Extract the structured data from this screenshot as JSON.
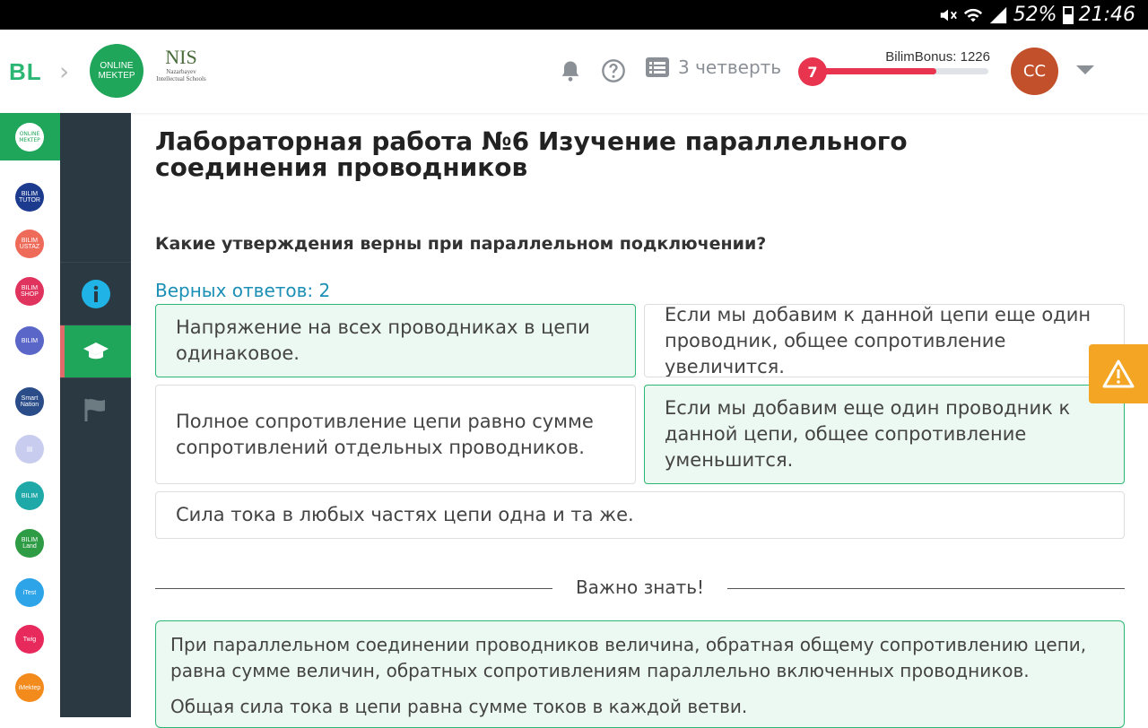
{
  "status_bar": {
    "battery": "52%",
    "time": "21:46"
  },
  "header": {
    "bl_logo": "BL",
    "online_mektep_line1": "ONLINE",
    "online_mektep_line2": "MEKTEP",
    "nis_big": "NIS",
    "nis_small": "Nazarbayev Intellectual Schools",
    "quarter": "3 четверть",
    "bonus_label": "BilimBonus:",
    "bonus_value": "1226",
    "level": "7",
    "level_progress": 0.7,
    "avatar_initials": "CC",
    "colors": {
      "accent": "#1fa65a",
      "level": "#e8344e",
      "avatar": "#c2502a"
    }
  },
  "rail_apps": [
    {
      "name": "online-mektep-app",
      "label": "ONLINE MEKTEP",
      "color": "#1fa65a"
    },
    {
      "name": "bilim-tutor-app",
      "label": "BILIM TUTOR",
      "color": "#1d3b8e"
    },
    {
      "name": "bilim-ustaz-app",
      "label": "BILIM USTAZ",
      "color": "#ee6b5a"
    },
    {
      "name": "bilim-shop-app",
      "label": "BILIM SHOP",
      "color": "#e0335e"
    },
    {
      "name": "bilim-expert-app",
      "label": "BILIM",
      "color": "#5a67c8"
    },
    {
      "name": "smart-nation-app",
      "label": "Smart Nation",
      "color": "#2a4d8a"
    },
    {
      "name": "news-app",
      "label": "▤",
      "color": "#c8cdf0"
    },
    {
      "name": "bilim-olimp-app",
      "label": "BILIM",
      "color": "#1fa8a8"
    },
    {
      "name": "bilim-land-app",
      "label": "BILIM Land",
      "color": "#2e9b45"
    },
    {
      "name": "itest-app",
      "label": "iTest",
      "color": "#2da3e8"
    },
    {
      "name": "twig-app",
      "label": "Twig",
      "color": "#e8295c"
    },
    {
      "name": "imektep-app",
      "label": "iMektep",
      "color": "#f28a1c"
    }
  ],
  "lesson": {
    "title": "Лабораторная работа №6 Изучение параллельного соединения проводников",
    "question": "Какие утверждения верны при параллельном подключении?",
    "answers_count": "Верных ответов: 2",
    "options": [
      {
        "text": "Напряжение на всех проводниках в цепи одинаковое.",
        "selected": true
      },
      {
        "text": "Если мы добавим к данной цепи еще один проводник, общее сопротивление увеличится.",
        "selected": false
      },
      {
        "text": "Полное сопротивление цепи равно сумме сопротивлений отдельных проводников.",
        "selected": false
      },
      {
        "text": "Если мы добавим еще один проводник к данной цепи, общее сопротивление уменьшится.",
        "selected": true
      },
      {
        "text": "Сила тока в любых частях цепи одна и та же.",
        "selected": false
      }
    ],
    "important_heading": "Важно знать!",
    "info": [
      "При параллельном соединении проводников величина, обратная общему сопротивлению цепи, равна сумме величин, обратных сопротивлениям параллельно включенных проводников.",
      "Общая сила тока в цепи равна сумме токов в каждой ветви."
    ]
  }
}
